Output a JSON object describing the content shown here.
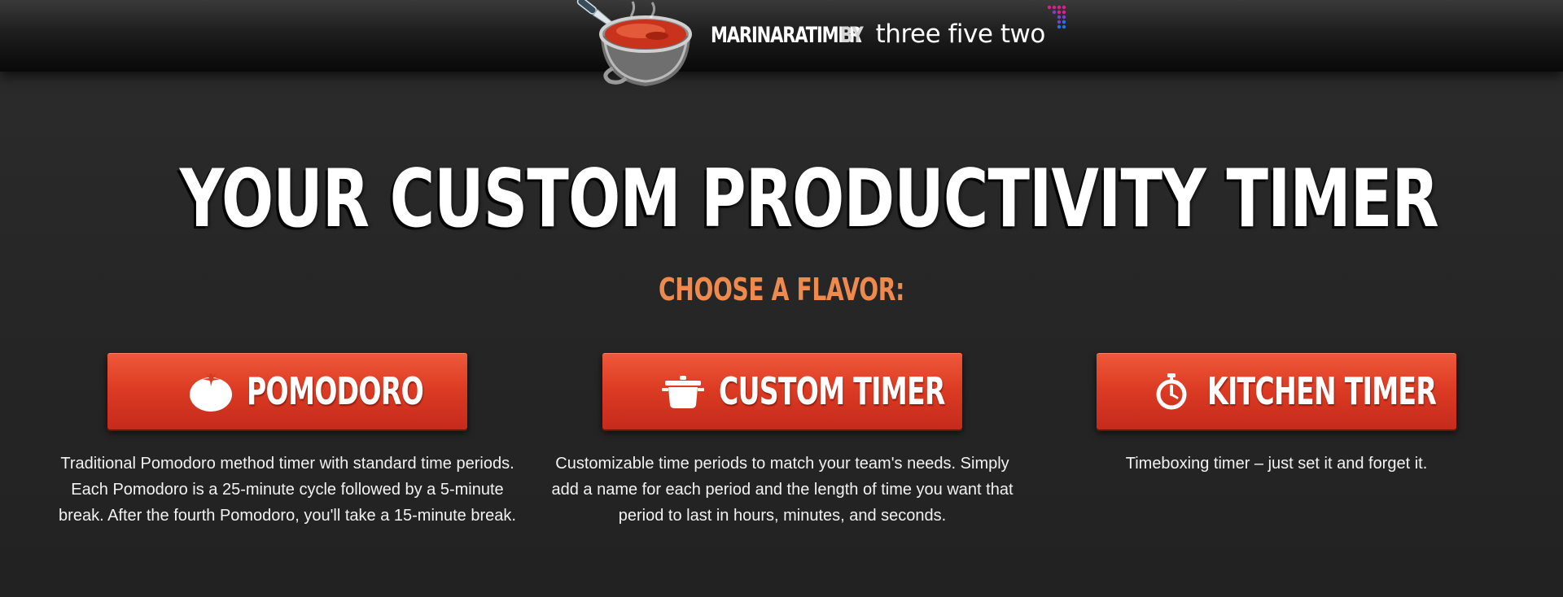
{
  "header": {
    "app_name": "MARINARATIMER",
    "by": "BY",
    "company": "three five two",
    "logo_icon": "marinara-pot-icon"
  },
  "main": {
    "title": "YOUR CUSTOM PRODUCTIVITY TIMER",
    "subtitle": "CHOOSE A FLAVOR:"
  },
  "options": [
    {
      "label": "POMODORO",
      "icon": "tomato-icon",
      "description": "Traditional Pomodoro method timer with standard time periods. Each Pomodoro is a 25-minute cycle followed by a 5-minute break. After the fourth Pomodoro, you'll take a 15-minute break."
    },
    {
      "label": "CUSTOM TIMER",
      "icon": "pot-icon",
      "description": "Customizable time periods to match your team's needs. Simply add a name for each period and the length of time you want that period to last in hours, minutes, and seconds."
    },
    {
      "label": "KITCHEN TIMER",
      "icon": "stopwatch-icon",
      "description": "Timeboxing timer – just set it and forget it."
    }
  ],
  "colors": {
    "background": "#262626",
    "accent_orange": "#ee8a4e",
    "button_red": "#db3b23",
    "text": "#ffffff"
  }
}
